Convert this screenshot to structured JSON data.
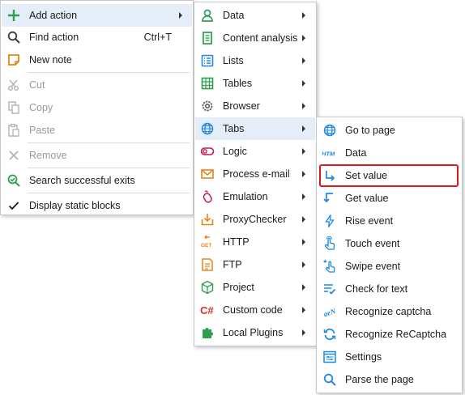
{
  "main_menu": {
    "items": [
      {
        "label": "Add action",
        "shortcut": "",
        "icon": "plus-icon"
      },
      {
        "label": "Find action",
        "shortcut": "Ctrl+T",
        "icon": "search-icon"
      },
      {
        "label": "New note",
        "shortcut": "",
        "icon": "note-icon"
      },
      {
        "label": "Cut",
        "shortcut": "",
        "icon": "scissors-icon"
      },
      {
        "label": "Copy",
        "shortcut": "",
        "icon": "copy-icon"
      },
      {
        "label": "Paste",
        "shortcut": "",
        "icon": "paste-icon"
      },
      {
        "label": "Remove",
        "shortcut": "",
        "icon": "remove-icon"
      },
      {
        "label": "Search successful exits",
        "shortcut": "",
        "icon": "search-check-icon"
      },
      {
        "label": "Display static blocks",
        "shortcut": "",
        "icon": "checkmark-icon"
      }
    ]
  },
  "add_action_menu": {
    "items": [
      {
        "label": "Data",
        "icon": "person-icon"
      },
      {
        "label": "Content analysis",
        "icon": "document-icon"
      },
      {
        "label": "Lists",
        "icon": "list-icon"
      },
      {
        "label": "Tables",
        "icon": "table-icon"
      },
      {
        "label": "Browser",
        "icon": "gear-icon"
      },
      {
        "label": "Tabs",
        "icon": "globe-icon"
      },
      {
        "label": "Logic",
        "icon": "toggle-icon"
      },
      {
        "label": "Process e-mail",
        "icon": "envelope-icon"
      },
      {
        "label": "Emulation",
        "icon": "mouse-icon"
      },
      {
        "label": "ProxyChecker",
        "icon": "download-box-icon"
      },
      {
        "label": "HTTP",
        "icon": "http-get-icon"
      },
      {
        "label": "FTP",
        "icon": "ftp-icon"
      },
      {
        "label": "Project",
        "icon": "cube-icon"
      },
      {
        "label": "Custom code",
        "icon": "csharp-icon"
      },
      {
        "label": "Local Plugins",
        "icon": "puzzle-icon"
      }
    ]
  },
  "tabs_menu": {
    "items": [
      {
        "label": "Go to page",
        "icon": "globe-icon"
      },
      {
        "label": "Data",
        "icon": "htm-icon",
        "icon_text": "HTM"
      },
      {
        "label": "Set value",
        "icon": "set-value-arrow-icon"
      },
      {
        "label": "Get value",
        "icon": "get-value-arrow-icon"
      },
      {
        "label": "Rise event",
        "icon": "lightning-icon"
      },
      {
        "label": "Touch event",
        "icon": "touch-hand-icon"
      },
      {
        "label": "Swipe event",
        "icon": "swipe-hand-icon"
      },
      {
        "label": "Check for text",
        "icon": "check-text-icon"
      },
      {
        "label": "Recognize captcha",
        "icon": "captcha-icon"
      },
      {
        "label": "Recognize ReCaptcha",
        "icon": "recaptcha-icon"
      },
      {
        "label": "Settings",
        "icon": "settings-window-icon"
      },
      {
        "label": "Parse the page",
        "icon": "search-icon"
      }
    ]
  },
  "colors": {
    "highlight": "#e5eef8",
    "accent_blue": "#1e88e5",
    "green": "#2e9e4f",
    "orange": "#e8841a",
    "red_frame": "#e0191b",
    "disabled": "#9a9a9a"
  }
}
